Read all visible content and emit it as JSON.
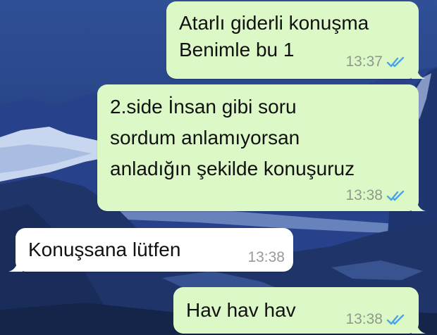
{
  "messages": [
    {
      "direction": "outgoing",
      "lines": [
        "Atarlı giderli konuşma",
        "Benimle bu 1"
      ],
      "time": "13:37",
      "status": "read"
    },
    {
      "direction": "outgoing",
      "lines": [
        "2.side İnsan gibi soru",
        "sordum anlamıyorsan",
        "anladığın şekilde konuşuruz"
      ],
      "time": "13:38",
      "status": "read"
    },
    {
      "direction": "incoming",
      "lines": [
        "Konuşsana lütfen"
      ],
      "time": "13:38"
    },
    {
      "direction": "outgoing",
      "lines": [
        "Hav hav hav"
      ],
      "time": "13:38",
      "status": "read"
    }
  ],
  "colors": {
    "outgoing_bubble": "#dcf8c6",
    "incoming_bubble": "#ffffff",
    "read_tick": "#4fa3e0"
  },
  "icons": {
    "read_receipt": "double-check-icon",
    "wallpaper": "mountain-landscape"
  }
}
